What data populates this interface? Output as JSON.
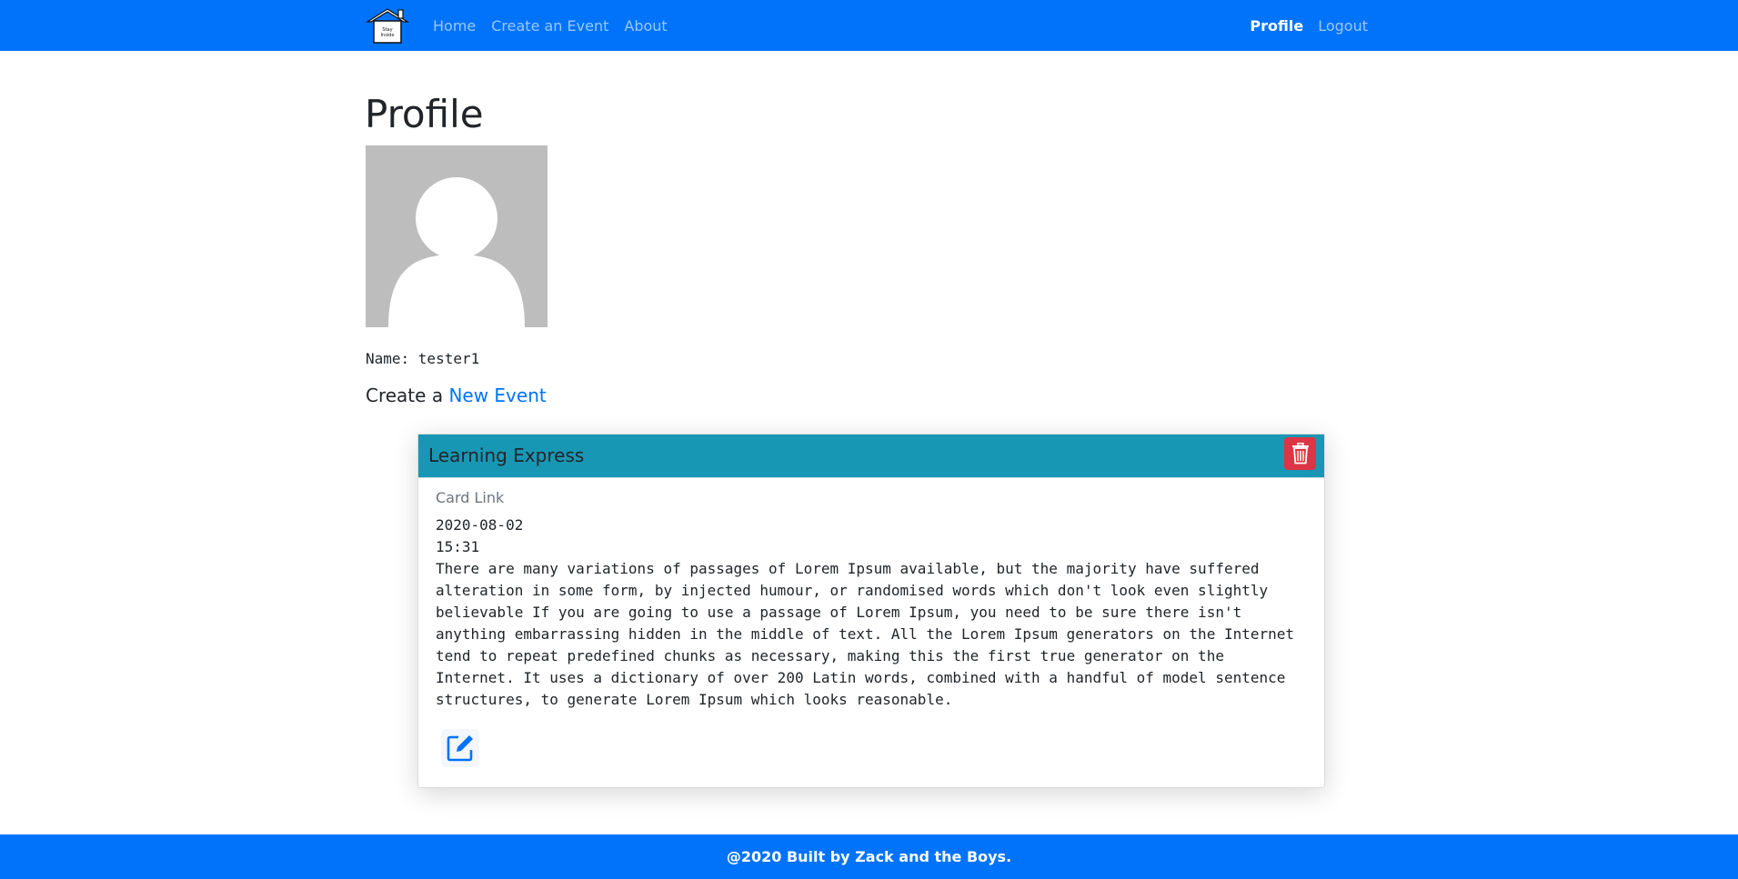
{
  "nav": {
    "logo_text": "Stay Inside",
    "links": [
      "Home",
      "Create an Event",
      "About"
    ],
    "right_links": [
      "Profile",
      "Logout"
    ],
    "colors": {
      "navbar": "#0073fb"
    }
  },
  "profile": {
    "title": "Profile",
    "name_line": "Name: tester1",
    "create_prefix": "Create a ",
    "create_link": "New Event"
  },
  "event_card": {
    "title": "Learning Express",
    "link": "Card Link",
    "date": "2020-08-02",
    "time": "15:31",
    "description": "There are many variations of passages of Lorem Ipsum available, but the majority have suffered alteration in some form, by injected humour, or randomised words which don't look even slightly believable If you are going to use a passage of Lorem Ipsum, you need to be sure there isn't anything embarrassing hidden in the middle of text. All the Lorem Ipsum generators on the Internet tend to repeat predefined chunks as necessary, making this the first true generator on the Internet. It uses a dictionary of over 200 Latin words, combined with a handful of model sentence structures, to generate Lorem Ipsum which looks reasonable.",
    "colors": {
      "header": "#1897b4",
      "delete": "#dc3545",
      "edit": "#0073fb"
    },
    "icons": {
      "delete": "trash-icon",
      "edit": "edit-icon"
    }
  },
  "footer": {
    "text": "@2020 Built by Zack and the Boys."
  }
}
